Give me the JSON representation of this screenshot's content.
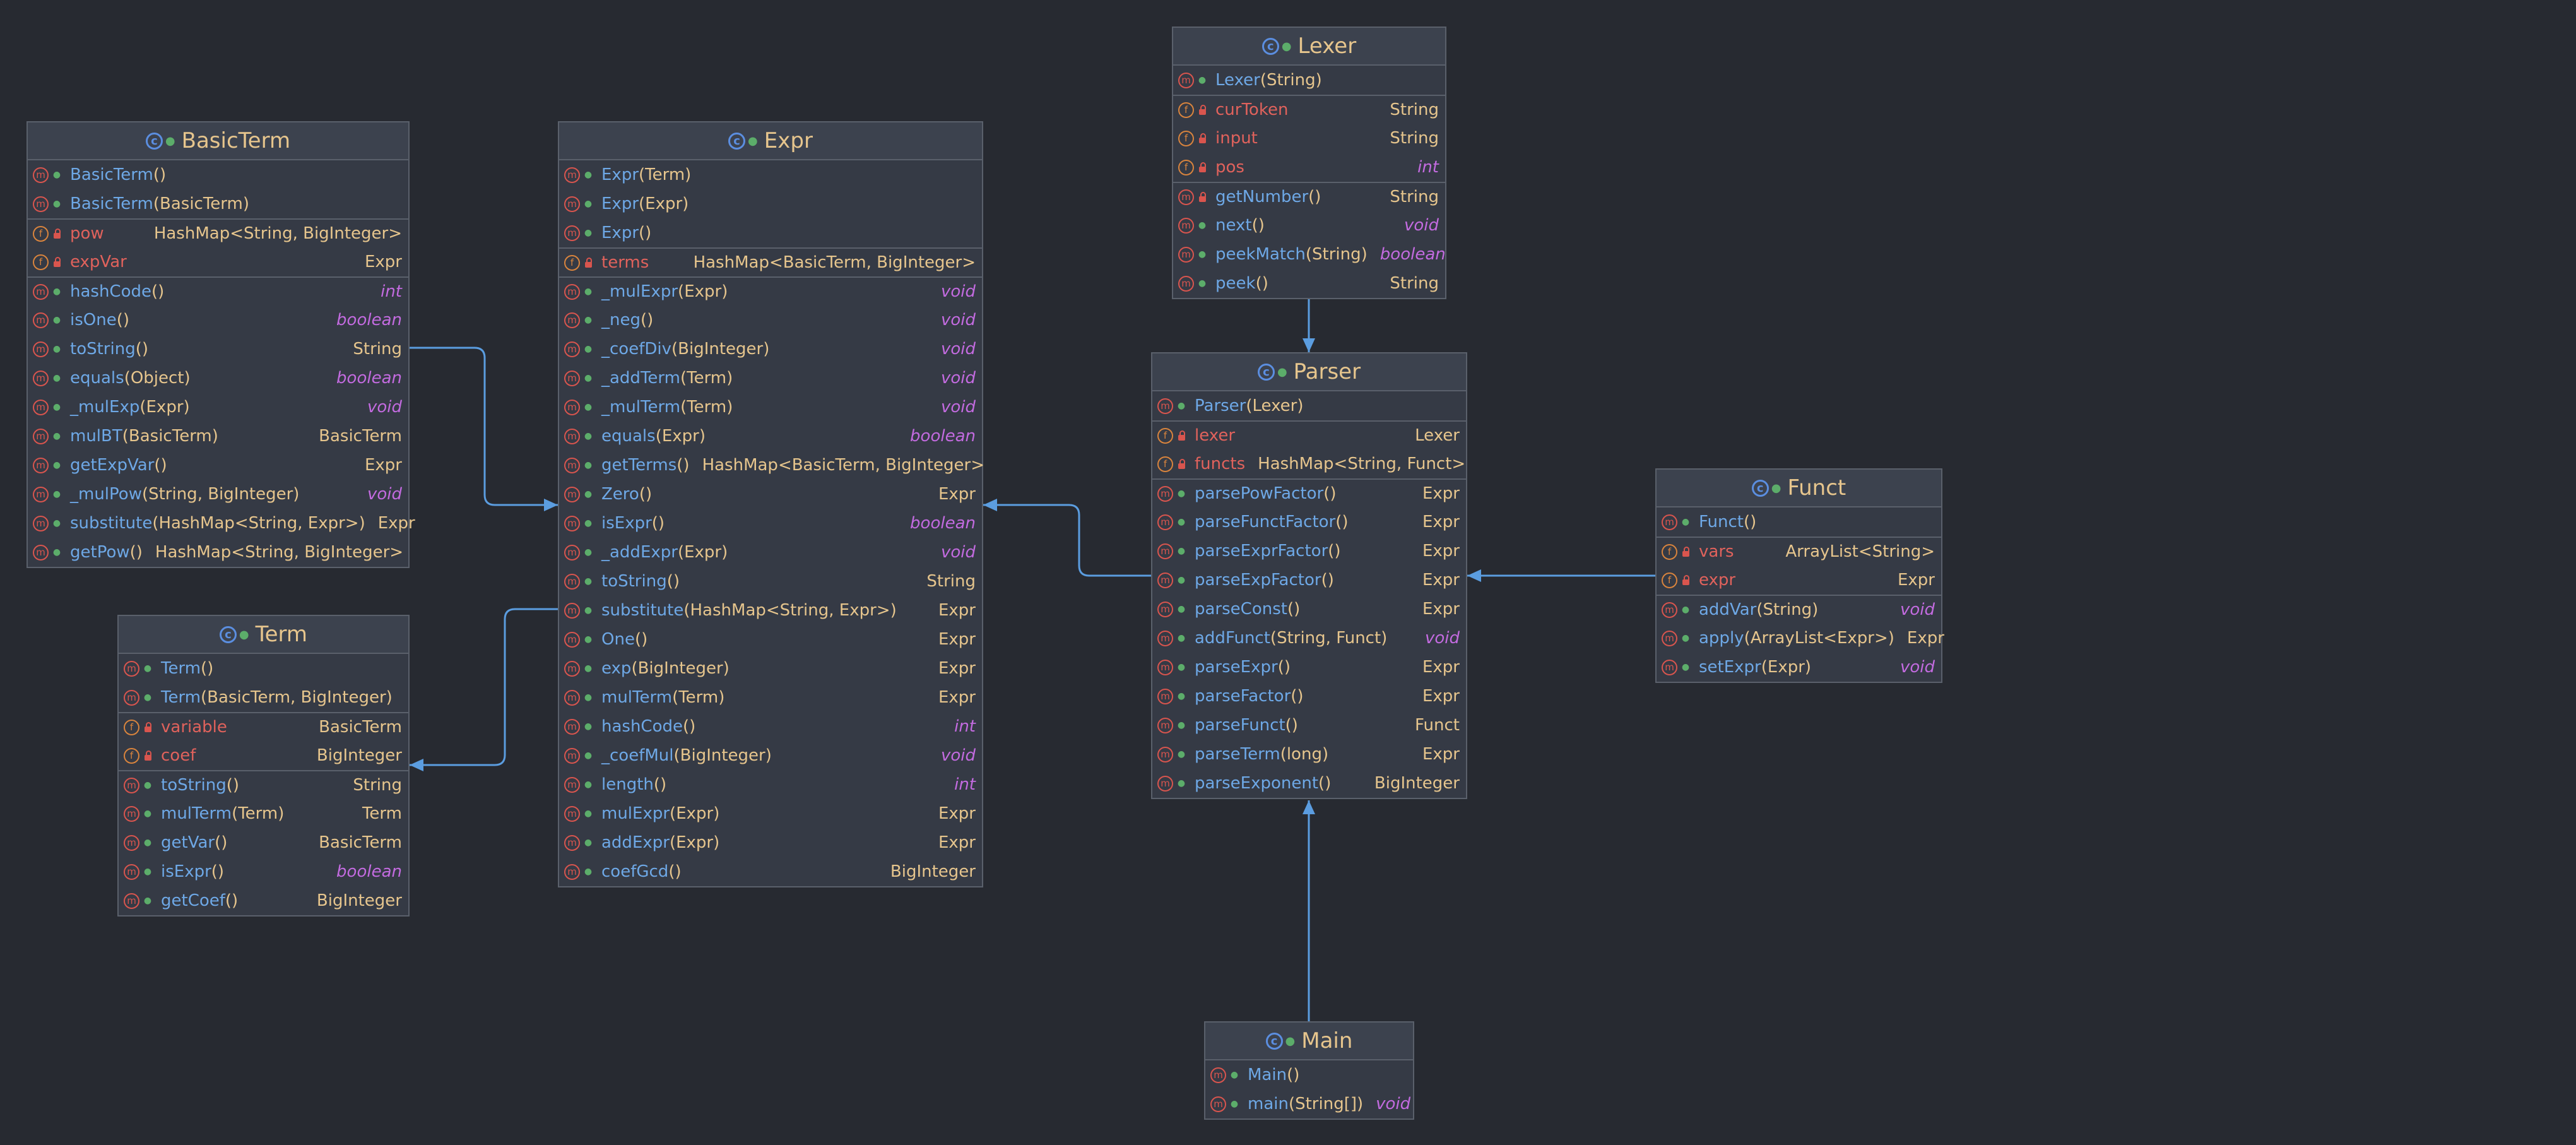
{
  "theme": {
    "background": "#272a31",
    "panel": "#353a45",
    "edge": "#5b9de0",
    "method_name": "#6ea8e6",
    "field_name": "#e0625c",
    "type": "#e6c58d",
    "keyword": "#c36be0"
  },
  "icons": {
    "class": "class-icon",
    "method": "method-icon",
    "field": "field-icon",
    "public": "public-icon",
    "private": "private-lock-icon"
  },
  "classes": [
    {
      "id": "basicterm",
      "name": "BasicTerm",
      "members": [
        {
          "kind": "m",
          "vis": "pub",
          "name": "BasicTerm",
          "args": "()",
          "type": ""
        },
        {
          "kind": "m",
          "vis": "pub",
          "name": "BasicTerm",
          "args": "(BasicTerm)",
          "type": ""
        },
        {
          "kind": "f",
          "vis": "prv",
          "name": "pow",
          "args": "",
          "type": "HashMap<String, BigInteger>",
          "sep": true
        },
        {
          "kind": "f",
          "vis": "prv",
          "name": "expVar",
          "args": "",
          "type": "Expr"
        },
        {
          "kind": "m",
          "vis": "pub",
          "name": "hashCode",
          "args": "()",
          "type": "int",
          "sep": true
        },
        {
          "kind": "m",
          "vis": "pub",
          "name": "isOne",
          "args": "()",
          "type": "boolean"
        },
        {
          "kind": "m",
          "vis": "pub",
          "name": "toString",
          "args": "()",
          "type": "String"
        },
        {
          "kind": "m",
          "vis": "pub",
          "name": "equals",
          "args": "(Object)",
          "type": "boolean"
        },
        {
          "kind": "m",
          "vis": "pub",
          "name": "_mulExp",
          "args": "(Expr)",
          "type": "void"
        },
        {
          "kind": "m",
          "vis": "pub",
          "name": "mulBT",
          "args": "(BasicTerm)",
          "type": "BasicTerm"
        },
        {
          "kind": "m",
          "vis": "pub",
          "name": "getExpVar",
          "args": "()",
          "type": "Expr"
        },
        {
          "kind": "m",
          "vis": "pub",
          "name": "_mulPow",
          "args": "(String, BigInteger)",
          "type": "void"
        },
        {
          "kind": "m",
          "vis": "pub",
          "name": "substitute",
          "args": "(HashMap<String, Expr>)",
          "type": "Expr"
        },
        {
          "kind": "m",
          "vis": "pub",
          "name": "getPow",
          "args": "()",
          "type": "HashMap<String, BigInteger>"
        }
      ]
    },
    {
      "id": "term",
      "name": "Term",
      "members": [
        {
          "kind": "m",
          "vis": "pub",
          "name": "Term",
          "args": "()",
          "type": ""
        },
        {
          "kind": "m",
          "vis": "pub",
          "name": "Term",
          "args": "(BasicTerm, BigInteger)",
          "type": ""
        },
        {
          "kind": "f",
          "vis": "prv",
          "name": "variable",
          "args": "",
          "type": "BasicTerm",
          "sep": true
        },
        {
          "kind": "f",
          "vis": "prv",
          "name": "coef",
          "args": "",
          "type": "BigInteger"
        },
        {
          "kind": "m",
          "vis": "pub",
          "name": "toString",
          "args": "()",
          "type": "String",
          "sep": true
        },
        {
          "kind": "m",
          "vis": "pub",
          "name": "mulTerm",
          "args": "(Term)",
          "type": "Term"
        },
        {
          "kind": "m",
          "vis": "pub",
          "name": "getVar",
          "args": "()",
          "type": "BasicTerm"
        },
        {
          "kind": "m",
          "vis": "pub",
          "name": "isExpr",
          "args": "()",
          "type": "boolean"
        },
        {
          "kind": "m",
          "vis": "pub",
          "name": "getCoef",
          "args": "()",
          "type": "BigInteger"
        }
      ]
    },
    {
      "id": "expr",
      "name": "Expr",
      "members": [
        {
          "kind": "m",
          "vis": "pub",
          "name": "Expr",
          "args": "(Term)",
          "type": ""
        },
        {
          "kind": "m",
          "vis": "pub",
          "name": "Expr",
          "args": "(Expr)",
          "type": ""
        },
        {
          "kind": "m",
          "vis": "pub",
          "name": "Expr",
          "args": "()",
          "type": ""
        },
        {
          "kind": "f",
          "vis": "prv",
          "name": "terms",
          "args": "",
          "type": "HashMap<BasicTerm, BigInteger>",
          "sep": true
        },
        {
          "kind": "m",
          "vis": "pub",
          "name": "_mulExpr",
          "args": "(Expr)",
          "type": "void",
          "sep": true
        },
        {
          "kind": "m",
          "vis": "pub",
          "name": "_neg",
          "args": "()",
          "type": "void"
        },
        {
          "kind": "m",
          "vis": "pub",
          "name": "_coefDiv",
          "args": "(BigInteger)",
          "type": "void"
        },
        {
          "kind": "m",
          "vis": "pub",
          "name": "_addTerm",
          "args": "(Term)",
          "type": "void"
        },
        {
          "kind": "m",
          "vis": "pub",
          "name": "_mulTerm",
          "args": "(Term)",
          "type": "void"
        },
        {
          "kind": "m",
          "vis": "pub",
          "name": "equals",
          "args": "(Expr)",
          "type": "boolean"
        },
        {
          "kind": "m",
          "vis": "pub",
          "name": "getTerms",
          "args": "()",
          "type": "HashMap<BasicTerm, BigInteger>"
        },
        {
          "kind": "m",
          "vis": "pub",
          "name": "Zero",
          "args": "()",
          "type": "Expr"
        },
        {
          "kind": "m",
          "vis": "pub",
          "name": "isExpr",
          "args": "()",
          "type": "boolean"
        },
        {
          "kind": "m",
          "vis": "pub",
          "name": "_addExpr",
          "args": "(Expr)",
          "type": "void"
        },
        {
          "kind": "m",
          "vis": "pub",
          "name": "toString",
          "args": "()",
          "type": "String"
        },
        {
          "kind": "m",
          "vis": "pub",
          "name": "substitute",
          "args": "(HashMap<String, Expr>)",
          "type": "Expr"
        },
        {
          "kind": "m",
          "vis": "pub",
          "name": "One",
          "args": "()",
          "type": "Expr"
        },
        {
          "kind": "m",
          "vis": "pub",
          "name": "exp",
          "args": "(BigInteger)",
          "type": "Expr"
        },
        {
          "kind": "m",
          "vis": "pub",
          "name": "mulTerm",
          "args": "(Term)",
          "type": "Expr"
        },
        {
          "kind": "m",
          "vis": "pub",
          "name": "hashCode",
          "args": "()",
          "type": "int"
        },
        {
          "kind": "m",
          "vis": "pub",
          "name": "_coefMul",
          "args": "(BigInteger)",
          "type": "void"
        },
        {
          "kind": "m",
          "vis": "pub",
          "name": "length",
          "args": "()",
          "type": "int"
        },
        {
          "kind": "m",
          "vis": "pub",
          "name": "mulExpr",
          "args": "(Expr)",
          "type": "Expr"
        },
        {
          "kind": "m",
          "vis": "pub",
          "name": "addExpr",
          "args": "(Expr)",
          "type": "Expr"
        },
        {
          "kind": "m",
          "vis": "pub",
          "name": "coefGcd",
          "args": "()",
          "type": "BigInteger"
        }
      ]
    },
    {
      "id": "lexer",
      "name": "Lexer",
      "members": [
        {
          "kind": "m",
          "vis": "pub",
          "name": "Lexer",
          "args": "(String)",
          "type": ""
        },
        {
          "kind": "f",
          "vis": "prv",
          "name": "curToken",
          "args": "",
          "type": "String",
          "sep": true
        },
        {
          "kind": "f",
          "vis": "prv",
          "name": "input",
          "args": "",
          "type": "String"
        },
        {
          "kind": "f",
          "vis": "prv",
          "name": "pos",
          "args": "",
          "type": "int"
        },
        {
          "kind": "m",
          "vis": "prv",
          "name": "getNumber",
          "args": "()",
          "type": "String",
          "sep": true
        },
        {
          "kind": "m",
          "vis": "pub",
          "name": "next",
          "args": "()",
          "type": "void"
        },
        {
          "kind": "m",
          "vis": "pub",
          "name": "peekMatch",
          "args": "(String)",
          "type": "boolean"
        },
        {
          "kind": "m",
          "vis": "pub",
          "name": "peek",
          "args": "()",
          "type": "String"
        }
      ]
    },
    {
      "id": "parser",
      "name": "Parser",
      "members": [
        {
          "kind": "m",
          "vis": "pub",
          "name": "Parser",
          "args": "(Lexer)",
          "type": ""
        },
        {
          "kind": "f",
          "vis": "prv",
          "name": "lexer",
          "args": "",
          "type": "Lexer",
          "sep": true
        },
        {
          "kind": "f",
          "vis": "prv",
          "name": "functs",
          "args": "",
          "type": "HashMap<String, Funct>"
        },
        {
          "kind": "m",
          "vis": "pub",
          "name": "parsePowFactor",
          "args": "()",
          "type": "Expr",
          "sep": true
        },
        {
          "kind": "m",
          "vis": "pub",
          "name": "parseFunctFactor",
          "args": "()",
          "type": "Expr"
        },
        {
          "kind": "m",
          "vis": "pub",
          "name": "parseExprFactor",
          "args": "()",
          "type": "Expr"
        },
        {
          "kind": "m",
          "vis": "pub",
          "name": "parseExpFactor",
          "args": "()",
          "type": "Expr"
        },
        {
          "kind": "m",
          "vis": "pub",
          "name": "parseConst",
          "args": "()",
          "type": "Expr"
        },
        {
          "kind": "m",
          "vis": "pub",
          "name": "addFunct",
          "args": "(String, Funct)",
          "type": "void"
        },
        {
          "kind": "m",
          "vis": "pub",
          "name": "parseExpr",
          "args": "()",
          "type": "Expr"
        },
        {
          "kind": "m",
          "vis": "pub",
          "name": "parseFactor",
          "args": "()",
          "type": "Expr"
        },
        {
          "kind": "m",
          "vis": "pub",
          "name": "parseFunct",
          "args": "()",
          "type": "Funct"
        },
        {
          "kind": "m",
          "vis": "pub",
          "name": "parseTerm",
          "args": "(long)",
          "type": "Expr"
        },
        {
          "kind": "m",
          "vis": "pub",
          "name": "parseExponent",
          "args": "()",
          "type": "BigInteger"
        }
      ]
    },
    {
      "id": "funct",
      "name": "Funct",
      "members": [
        {
          "kind": "m",
          "vis": "pub",
          "name": "Funct",
          "args": "()",
          "type": ""
        },
        {
          "kind": "f",
          "vis": "prv",
          "name": "vars",
          "args": "",
          "type": "ArrayList<String>",
          "sep": true
        },
        {
          "kind": "f",
          "vis": "prv",
          "name": "expr",
          "args": "",
          "type": "Expr"
        },
        {
          "kind": "m",
          "vis": "pub",
          "name": "addVar",
          "args": "(String)",
          "type": "void",
          "sep": true
        },
        {
          "kind": "m",
          "vis": "pub",
          "name": "apply",
          "args": "(ArrayList<Expr>)",
          "type": "Expr"
        },
        {
          "kind": "m",
          "vis": "pub",
          "name": "setExpr",
          "args": "(Expr)",
          "type": "void"
        }
      ]
    },
    {
      "id": "main",
      "name": "Main",
      "members": [
        {
          "kind": "m",
          "vis": "pub",
          "name": "Main",
          "args": "()",
          "type": ""
        },
        {
          "kind": "m",
          "vis": "pub",
          "name": "main",
          "args": "(String[])",
          "type": "void"
        }
      ]
    }
  ],
  "edges": [
    {
      "from": "basicterm",
      "to": "expr"
    },
    {
      "from": "expr",
      "to": "term"
    },
    {
      "from": "parser",
      "to": "expr"
    },
    {
      "from": "lexer",
      "to": "parser"
    },
    {
      "from": "funct",
      "to": "parser"
    },
    {
      "from": "main",
      "to": "parser"
    }
  ]
}
